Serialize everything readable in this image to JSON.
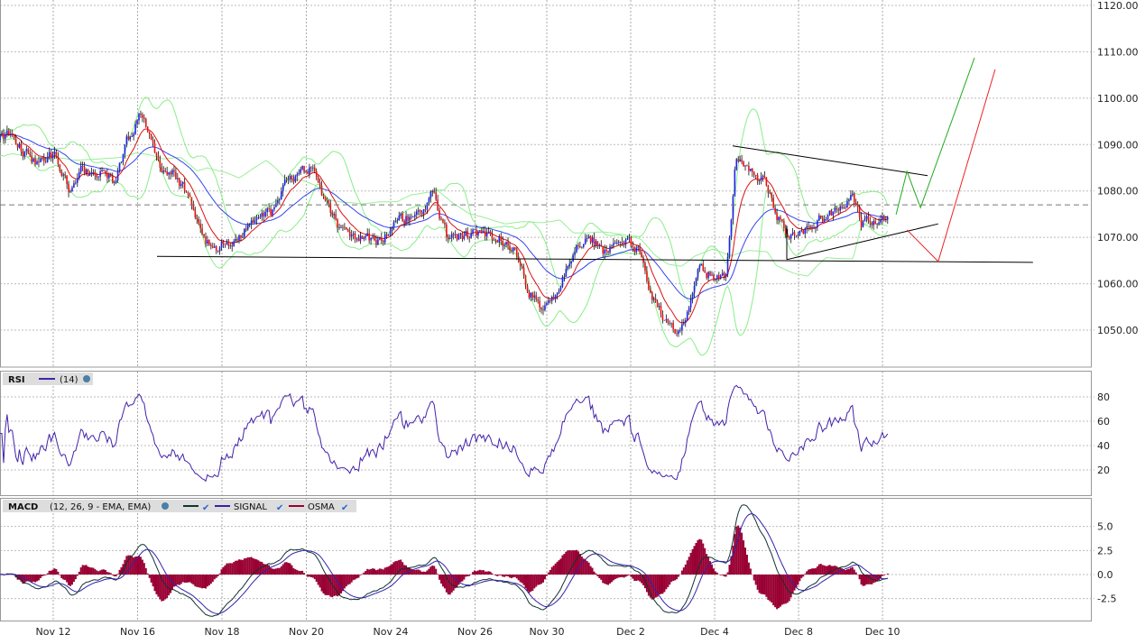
{
  "chart_data": {
    "type": "candlestick",
    "x_ticks": [
      {
        "t": 0,
        "label": "Nov 12"
      },
      {
        "t": 2,
        "label": "Nov 16"
      },
      {
        "t": 4,
        "label": "Nov 18"
      },
      {
        "t": 6,
        "label": "Nov 20"
      },
      {
        "t": 8,
        "label": "Nov 24"
      },
      {
        "t": 10,
        "label": "Nov 26"
      },
      {
        "t": 11.7,
        "label": "Nov 30"
      },
      {
        "t": 13.69,
        "label": "Dec 2"
      },
      {
        "t": 15.68,
        "label": "Dec 4"
      },
      {
        "t": 17.67,
        "label": "Dec 8"
      },
      {
        "t": 19.66,
        "label": "Dec 10"
      }
    ],
    "price_axis": {
      "ticks": [
        "1120.00",
        "1110.00",
        "1100.00",
        "1090.00",
        "1080.00",
        "1070.00",
        "1060.00",
        "1050.00"
      ],
      "range": [
        1043,
        1121
      ]
    },
    "price_path": [
      [
        -1.26,
        1091
      ],
      [
        -1.05,
        1092
      ],
      [
        -0.41,
        1086
      ],
      [
        0.02,
        1088
      ],
      [
        0.41,
        1080
      ],
      [
        0.66,
        1084
      ],
      [
        1.09,
        1084
      ],
      [
        1.41,
        1082
      ],
      [
        1.73,
        1090
      ],
      [
        2.05,
        1097
      ],
      [
        2.27,
        1092
      ],
      [
        2.48,
        1085
      ],
      [
        2.91,
        1083
      ],
      [
        3.23,
        1079
      ],
      [
        3.55,
        1069
      ],
      [
        3.87,
        1068
      ],
      [
        4.3,
        1069
      ],
      [
        4.73,
        1073
      ],
      [
        5.16,
        1075
      ],
      [
        5.48,
        1081
      ],
      [
        5.8,
        1083
      ],
      [
        6.12,
        1085
      ],
      [
        6.44,
        1078
      ],
      [
        6.87,
        1071
      ],
      [
        7.29,
        1070
      ],
      [
        7.72,
        1069
      ],
      [
        8.15,
        1073
      ],
      [
        8.58,
        1075
      ],
      [
        9.01,
        1079
      ],
      [
        9.33,
        1070
      ],
      [
        9.65,
        1070
      ],
      [
        10.07,
        1071
      ],
      [
        10.5,
        1070
      ],
      [
        10.93,
        1068
      ],
      [
        11.25,
        1059
      ],
      [
        11.57,
        1055
      ],
      [
        11.89,
        1056
      ],
      [
        12.21,
        1065
      ],
      [
        12.64,
        1071
      ],
      [
        13.07,
        1067
      ],
      [
        13.5,
        1069
      ],
      [
        13.93,
        1067
      ],
      [
        14.14,
        1057
      ],
      [
        14.57,
        1052
      ],
      [
        14.89,
        1050
      ],
      [
        15.1,
        1057
      ],
      [
        15.32,
        1063
      ],
      [
        15.64,
        1062
      ],
      [
        15.96,
        1061
      ],
      [
        16.17,
        1086
      ],
      [
        16.49,
        1085
      ],
      [
        16.92,
        1081
      ],
      [
        17.13,
        1075
      ],
      [
        17.45,
        1070
      ],
      [
        17.78,
        1072
      ],
      [
        18.2,
        1074
      ],
      [
        18.63,
        1076
      ],
      [
        18.95,
        1079
      ],
      [
        19.17,
        1073
      ],
      [
        19.49,
        1074
      ],
      [
        19.81,
        1073
      ]
    ],
    "overlays": [
      {
        "name": "EMA fast",
        "period": 12,
        "color": "#dd1111"
      },
      {
        "name": "EMA slow",
        "period": 40,
        "color": "#3344ee"
      },
      {
        "name": "SMA long",
        "period": 200,
        "color": "#99ee99"
      },
      {
        "name": "Bollinger",
        "period": 20,
        "k": 2,
        "color": "#88ee88"
      }
    ],
    "annotations": {
      "dashed_level": 1077.0,
      "lines": [
        {
          "name": "support",
          "color": "#000000",
          "points": [
            [
              2.46,
              1065.9
            ],
            [
              23.23,
              1064.6
            ]
          ]
        },
        {
          "name": "triangle-upper",
          "color": "#000000",
          "points": [
            [
              16.11,
              1089.7
            ],
            [
              20.73,
              1083.3
            ]
          ]
        },
        {
          "name": "triangle-lower",
          "color": "#000000",
          "points": [
            [
              17.39,
              1065.2
            ],
            [
              20.98,
              1072.9
            ]
          ]
        },
        {
          "name": "triangle-side",
          "color": "#000000",
          "points": [
            [
              17.39,
              1065.2
            ],
            [
              17.39,
              1072.5
            ]
          ]
        },
        {
          "name": "bull-projection",
          "color": "#22aa22",
          "points": [
            [
              19.98,
              1074.9
            ],
            [
              20.24,
              1084.2
            ],
            [
              20.56,
              1076.4
            ],
            [
              21.84,
              1108.7
            ]
          ]
        },
        {
          "name": "bear-projection",
          "color": "#ee2222",
          "points": [
            [
              20.24,
              1071.6
            ],
            [
              20.98,
              1064.8
            ],
            [
              22.33,
              1106.2
            ]
          ]
        }
      ]
    },
    "rsi": {
      "label": "RSI",
      "params": "(14)",
      "period": 14,
      "color": "#4422aa",
      "ticks": [
        "80",
        "60",
        "40",
        "20"
      ],
      "range": [
        0,
        100
      ]
    },
    "macd": {
      "label": "MACD",
      "params": "(12, 26, 9 - EMA, EMA)",
      "fast": 12,
      "slow": 26,
      "signal": 9,
      "macd_color": "#113333",
      "signal_label": "SIGNAL",
      "signal_color": "#3322aa",
      "osma_label": "OSMA",
      "osma_color": "#990033",
      "ticks": [
        "5.0",
        "2.5",
        "0.0",
        "-2.5"
      ]
    }
  }
}
